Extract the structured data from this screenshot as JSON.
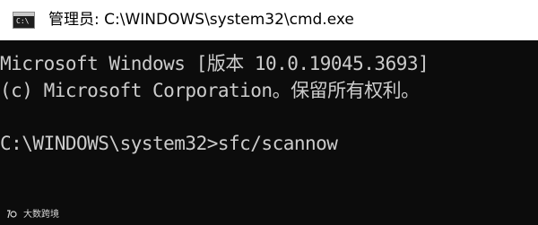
{
  "window": {
    "title": "管理员: C:\\WINDOWS\\system32\\cmd.exe",
    "icon": "cmd-icon",
    "icon_text": "C:\\"
  },
  "console": {
    "lines": [
      "Microsoft Windows [版本 10.0.19045.3693]",
      "(c) Microsoft Corporation。保留所有权利。",
      "C:\\WINDOWS\\system32>sfc/scannow"
    ]
  },
  "watermark": {
    "logo": "大数跨境-logo",
    "text": "大数跨境"
  },
  "colors": {
    "console_bg": "#0c0c0c",
    "console_text": "#cccccc",
    "titlebar_bg": "#ffffff"
  }
}
